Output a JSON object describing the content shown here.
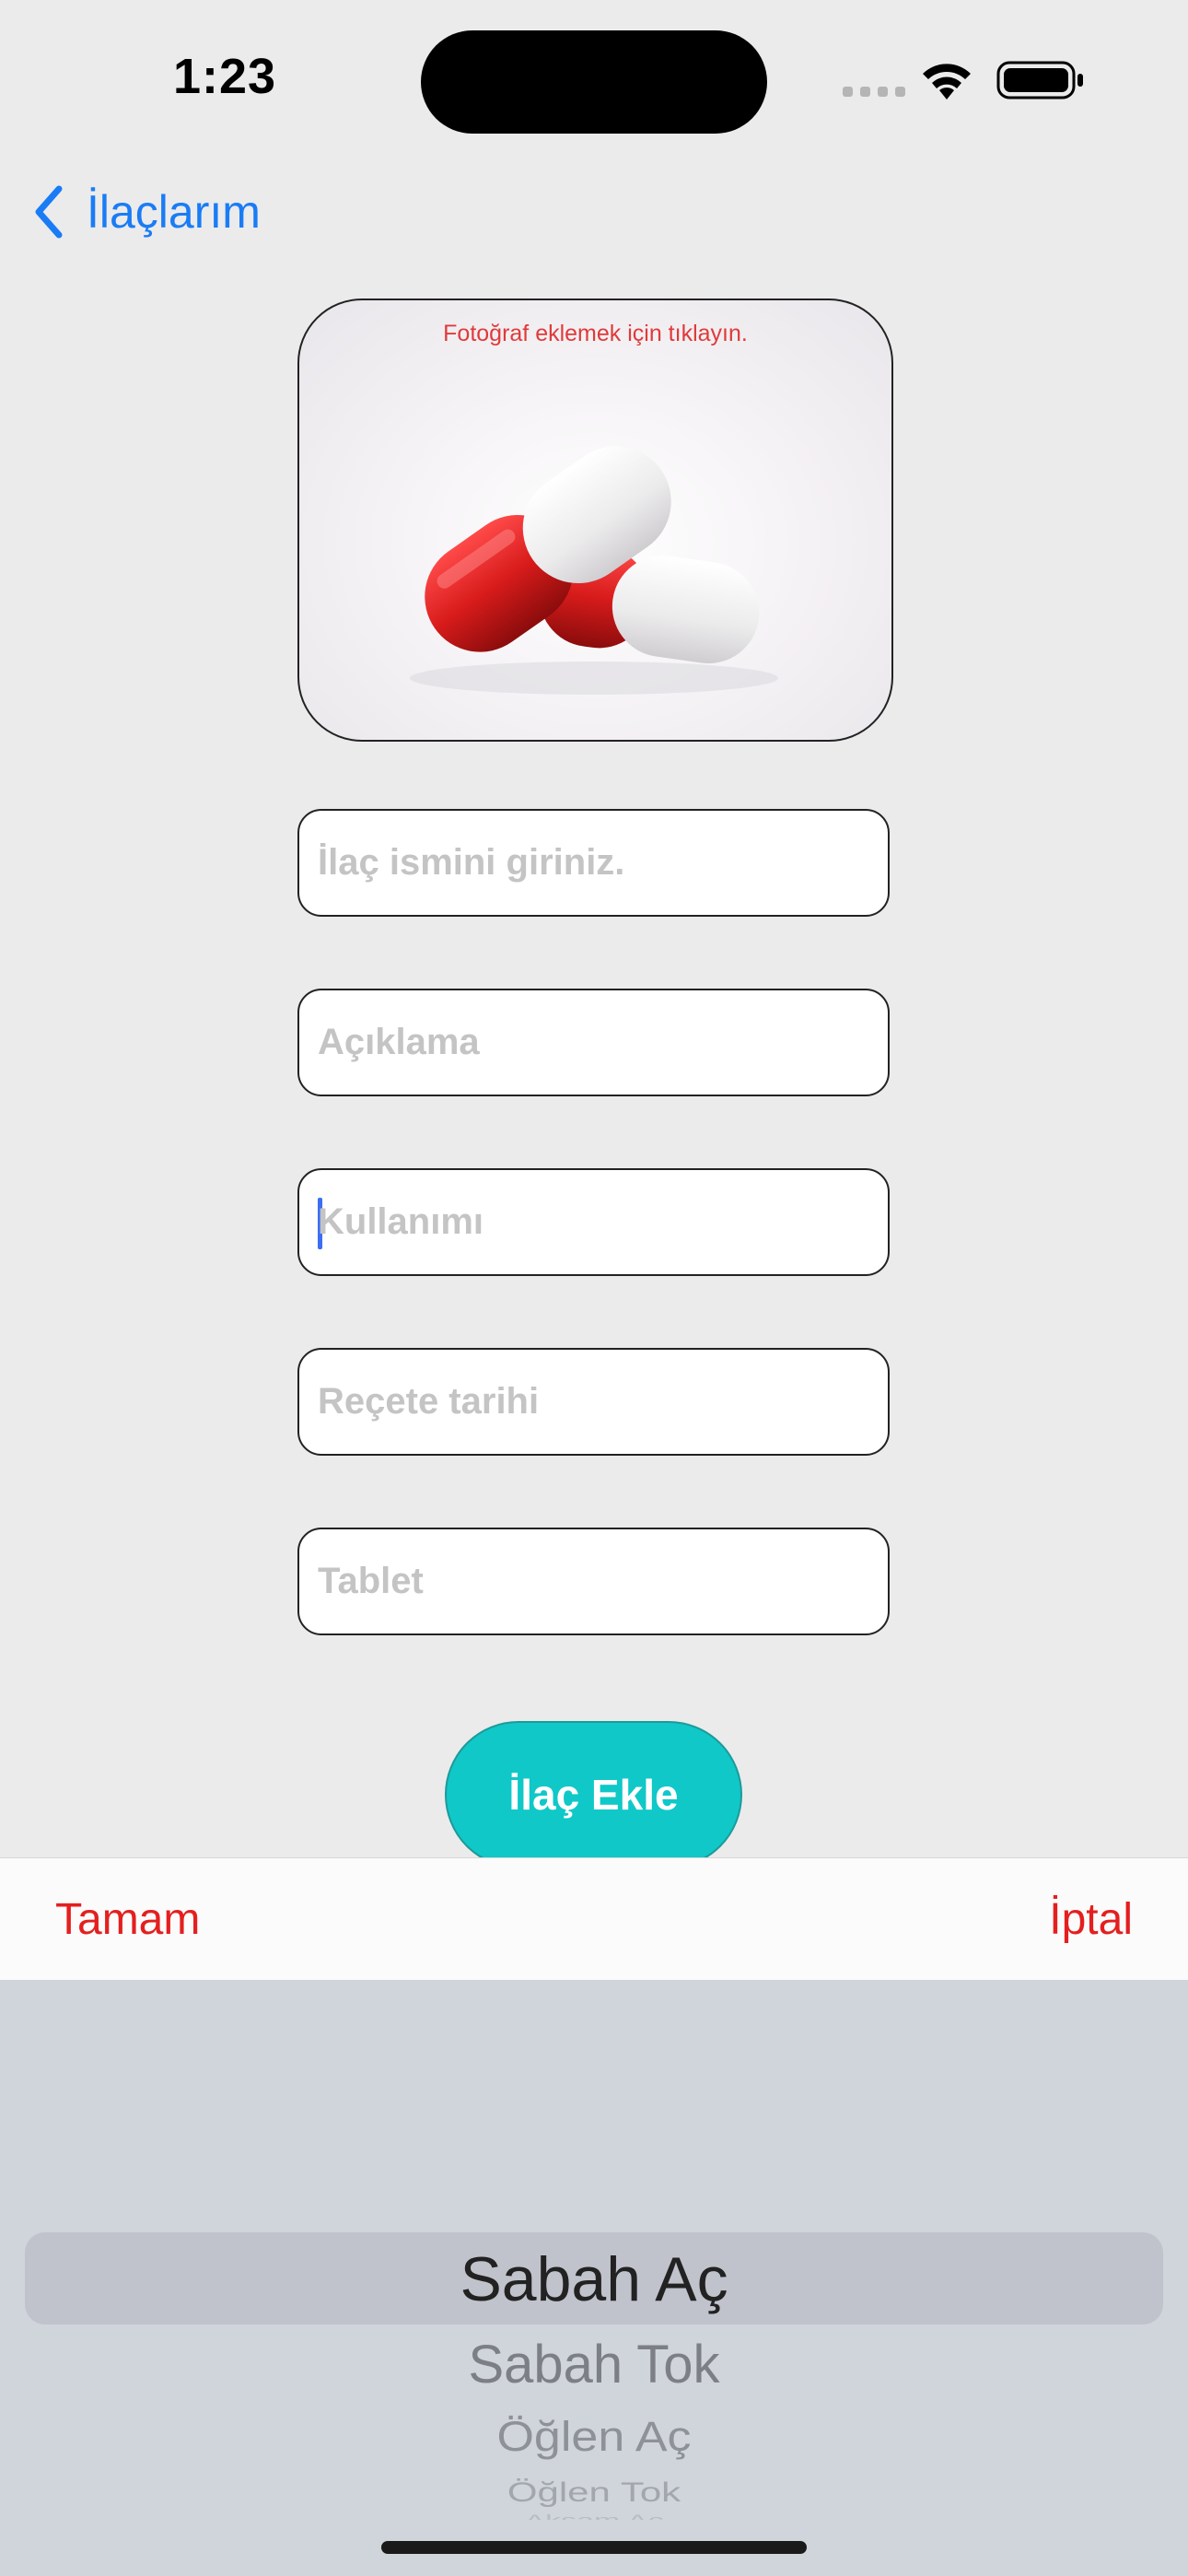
{
  "status_bar": {
    "time": "1:23"
  },
  "nav": {
    "back_label": "İlaçlarım"
  },
  "photo": {
    "hint": "Fotoğraf eklemek için tıklayın."
  },
  "form": {
    "name_placeholder": "İlaç ismini giriniz.",
    "description_placeholder": "Açıklama",
    "usage_placeholder": "Kullanımı",
    "prescription_date_placeholder": "Reçete tarihi",
    "tablet_placeholder": "Tablet",
    "add_button_label": "İlaç Ekle"
  },
  "toolbar": {
    "done_label": "Tamam",
    "cancel_label": "İptal"
  },
  "picker": {
    "selected": "Sabah Aç",
    "options": [
      "Sabah Aç",
      "Sabah Tok",
      "Öğlen Aç",
      "Öğlen Tok",
      "Akşam Aç"
    ]
  },
  "colors": {
    "accent_blue": "#1a7cf5",
    "button_teal": "#10c8c8",
    "toolbar_red": "#e41f1f",
    "hint_red": "#e03a3a"
  }
}
